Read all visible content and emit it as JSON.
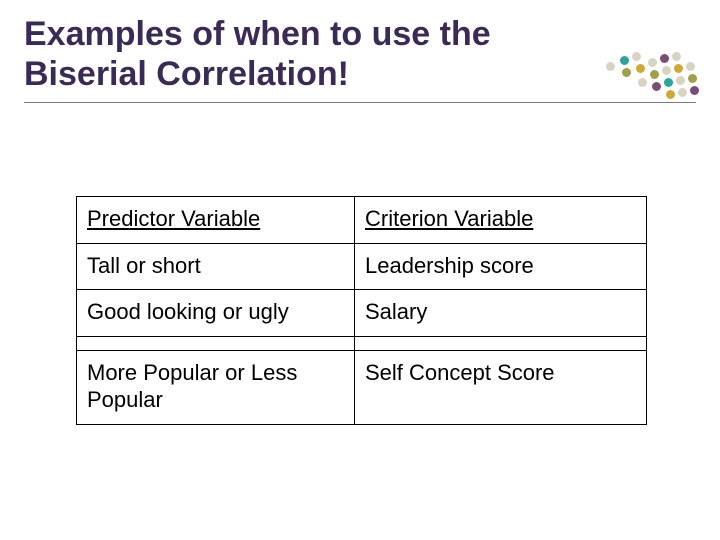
{
  "title": "Examples of when to use the Biserial Correlation!",
  "table": {
    "headers": {
      "left": "Predictor Variable",
      "right": "Criterion Variable"
    },
    "rows": [
      {
        "left": "Tall or short",
        "right": "Leadership score"
      },
      {
        "left": "Good looking or ugly",
        "right": "Salary"
      },
      {
        "left": "More Popular or Less Popular",
        "right": "Self Concept Score"
      }
    ]
  },
  "dots": {
    "colors": {
      "teal": "#2aa59a",
      "olive": "#9ea04a",
      "plum": "#7a4d74",
      "gold": "#d0a83a",
      "light": "#d8d4c2"
    }
  }
}
